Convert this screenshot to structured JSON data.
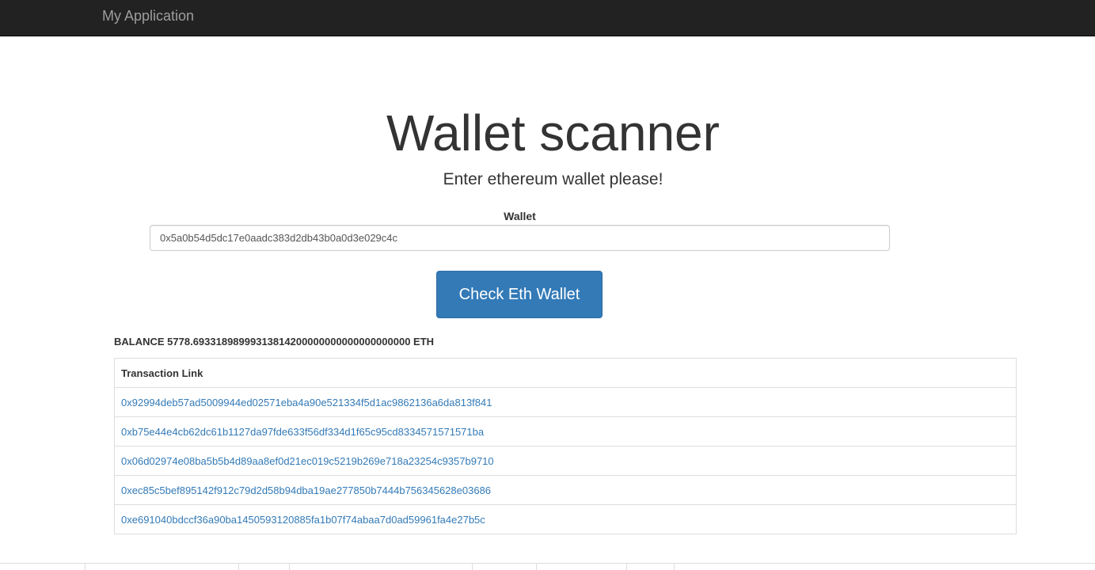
{
  "navbar": {
    "brand": "My Application"
  },
  "main": {
    "title": "Wallet scanner",
    "subtitle": "Enter ethereum wallet please!",
    "wallet_label": "Wallet",
    "wallet_value": "0x5a0b54d5dc17e0aadc383d2db43b0a0d3e029c4c",
    "check_button_label": "Check Eth Wallet",
    "balance_text": "BALANCE 5778.69331898999313814200000000000000000000 ETH"
  },
  "transactions": {
    "header": "Transaction Link",
    "links": [
      "0x92994deb57ad5009944ed02571eba4a90e521334f5d1ac9862136a6da813f841",
      "0xb75e44e4cb62dc61b1127da97fde633f56df334d1f65c95cd8334571571571ba",
      "0x06d02974e08ba5b5b4d89aa8ef0d21ec019c5219b269e718a23254c9357b9710",
      "0xec85c5bef895142f912c79d2d58b94dba19ae277850b7444b756345628e03686",
      "0xe691040bdccf36a90ba1450593120885fa1b07f74abaa7d0ad59961fa4e27b5c"
    ]
  },
  "colors": {
    "navbar_bg": "#222222",
    "brand_text": "#9d9d9d",
    "primary_button": "#337ab7",
    "link": "#337ab7"
  }
}
